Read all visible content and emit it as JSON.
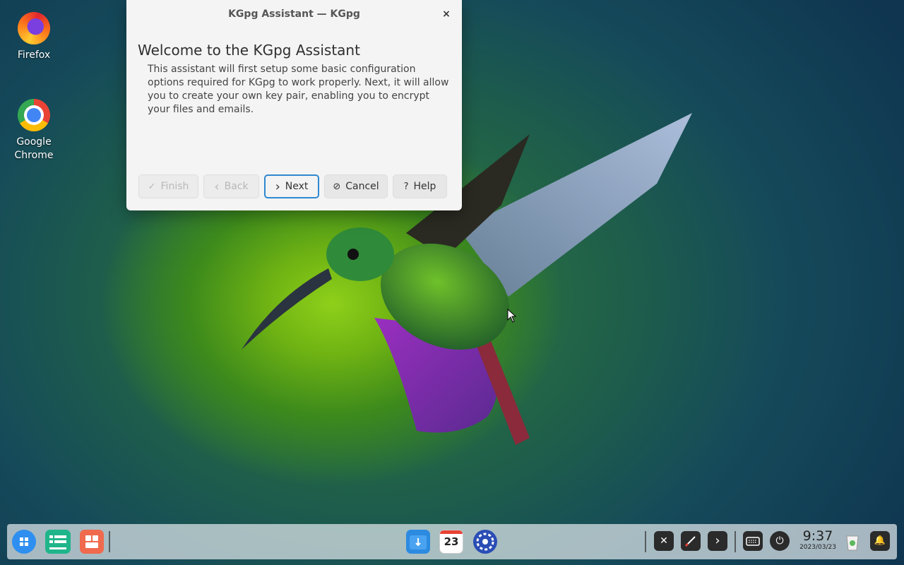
{
  "desktop": {
    "icons": [
      {
        "label": "Firefox"
      },
      {
        "label": "Google Chrome"
      }
    ]
  },
  "dialog": {
    "title": "KGpg Assistant — KGpg",
    "close_glyph": "×",
    "heading": "Welcome to the KGpg Assistant",
    "body": "This assistant will first setup some basic configuration options required for KGpg to work properly. Next, it will allow you to create your own key pair, enabling you to encrypt your files and emails.",
    "buttons": {
      "finish": {
        "label": "Finish",
        "glyph": "✓"
      },
      "back": {
        "label": "Back",
        "glyph": "‹"
      },
      "next": {
        "label": "Next",
        "glyph": "›"
      },
      "cancel": {
        "label": "Cancel",
        "glyph": "⊘"
      },
      "help": {
        "label": "Help",
        "glyph": "?"
      }
    }
  },
  "taskbar": {
    "calendar_day": "23",
    "clock_time": "9:37",
    "clock_date": "2023/03/23",
    "tray": {
      "mute_glyph": "✕",
      "expand_glyph": "›",
      "power_glyph": "⏻",
      "bell_glyph": "🔔"
    },
    "colors": {
      "launcher": "#2e8ff0",
      "terminal": "#1fb58a",
      "store": "#f06a4d"
    }
  }
}
